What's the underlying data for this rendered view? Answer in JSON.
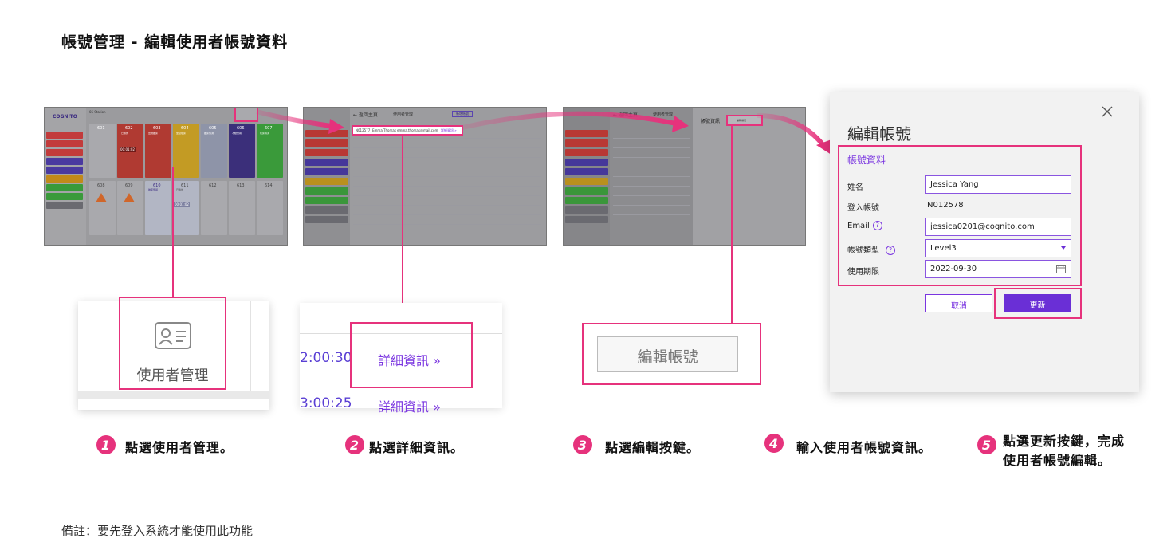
{
  "page": {
    "title": "帳號管理 - 編輯使用者帳號資料",
    "note": "備註：要先登入系統才能使用此功能"
  },
  "colors": {
    "accent_pink": "#e6327c",
    "purple": "#6a2fd6",
    "purple_text": "#7a35e0"
  },
  "thumb1": {
    "logo": "COGNITO",
    "station": "05 Station",
    "rooms_top": [
      "601",
      "602",
      "603",
      "604",
      "605",
      "606",
      "607"
    ],
    "rooms_top_status": [
      "",
      "已跌倒",
      "出現離床",
      "坐起在床",
      "離床偵測",
      "不動警報",
      "在床偵測"
    ],
    "timer1": "00:01:02",
    "rooms_bottom": [
      "608",
      "609",
      "610",
      "611",
      "612",
      "613",
      "614"
    ],
    "rooms_bottom_status": [
      "",
      "",
      "離床警報",
      "已跌倒",
      "",
      "",
      ""
    ],
    "timer2": "00:01:02"
  },
  "thumb2": {
    "back": "← 返回主頁",
    "header": "使用者管理",
    "action_chip": "新增帳號",
    "highlight_row": [
      "N012577",
      "Emma Thomas",
      "emma.thomas@mail.com",
      "詳細資訊 »"
    ]
  },
  "thumb3": {
    "back": "← 返回主頁",
    "header": "使用者管理",
    "panel_title": "帳號資訊",
    "panel_button": "編輯帳號"
  },
  "zoom1": {
    "label": "使用者管理",
    "icon": "id-card-icon"
  },
  "zoom2": {
    "rows": [
      {
        "time": "2:00:30",
        "link": "詳細資訊 »"
      },
      {
        "time": "3:00:25",
        "link": "詳細資訊 »"
      }
    ]
  },
  "zoom3": {
    "button": "編輯帳號"
  },
  "dialog": {
    "title": "編輯帳號",
    "section": "帳號資料",
    "name_label": "姓名",
    "name_value": "Jessica Yang",
    "login_label": "登入帳號",
    "login_value": "N012578",
    "email_label": "Email",
    "email_value": "jessica0201@cognito.com",
    "type_label": "帳號類型",
    "type_value": "Level3",
    "expiry_label": "使用期限",
    "expiry_value": "2022-09-30",
    "cancel": "取消",
    "update": "更新",
    "help_glyph": "?"
  },
  "steps": [
    {
      "num": "1",
      "text": "點選使用者管理。"
    },
    {
      "num": "2",
      "text": "點選詳細資訊。"
    },
    {
      "num": "3",
      "text": "點選編輯按鍵。"
    },
    {
      "num": "4",
      "text": "輸入使用者帳號資訊。"
    },
    {
      "num": "5",
      "line1": "點選更新按鍵，完成",
      "line2": "使用者帳號編輯。"
    }
  ]
}
